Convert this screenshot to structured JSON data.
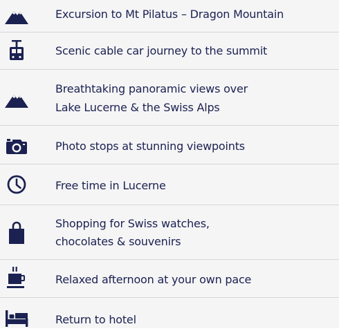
{
  "colors": {
    "text": "#1b2150",
    "icon": "#1b2150",
    "background": "#f5f5f6",
    "divider": "#d6d6da"
  },
  "items": [
    {
      "icon": "mountain-icon",
      "lines": [
        "Excursion to Mt Pilatus – Dragon Mountain"
      ]
    },
    {
      "icon": "cable-car-icon",
      "lines": [
        "Scenic cable car journey to the summit"
      ]
    },
    {
      "icon": "mountain-icon",
      "lines": [
        "Breathtaking panoramic views over",
        "Lake Lucerne & the Swiss Alps"
      ]
    },
    {
      "icon": "camera-icon",
      "lines": [
        "Photo stops at stunning viewpoints"
      ]
    },
    {
      "icon": "clock-icon",
      "lines": [
        "Free time in Lucerne"
      ]
    },
    {
      "icon": "shopping-bag-icon",
      "lines": [
        "Shopping for Swiss watches,",
        "chocolates & souvenirs"
      ]
    },
    {
      "icon": "coffee-cup-icon",
      "lines": [
        "Relaxed afternoon at your own pace"
      ]
    },
    {
      "icon": "bed-icon",
      "lines": [
        "Return to hotel"
      ]
    }
  ]
}
